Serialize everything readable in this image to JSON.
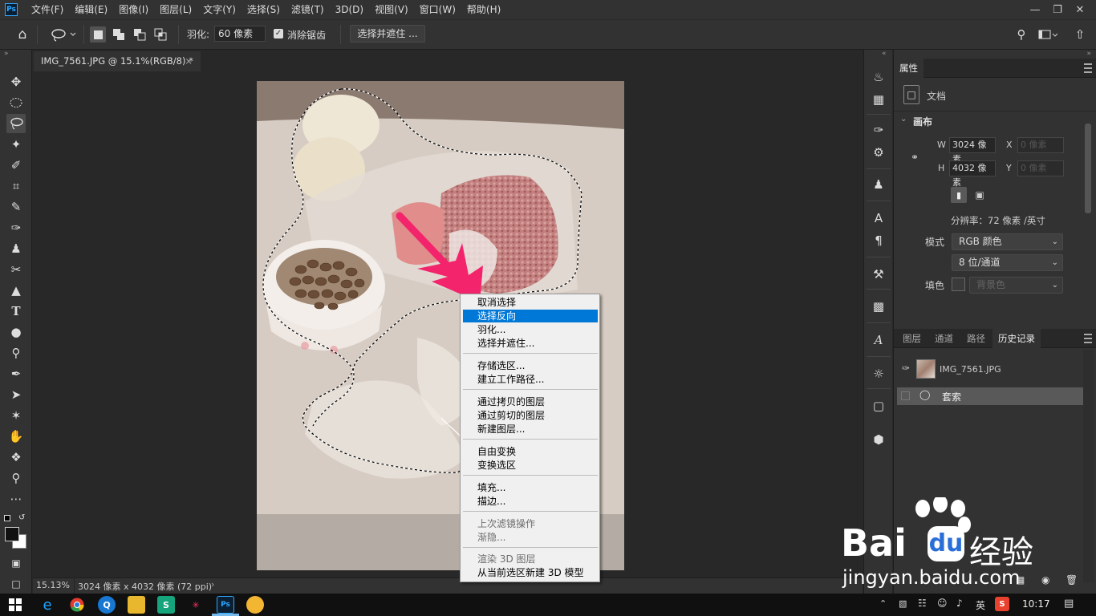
{
  "app": {
    "logo": "Ps",
    "colors": {
      "accent": "#31a8ff",
      "highlight": "#0078d7",
      "arrow": "#f3246c"
    }
  },
  "menubar": {
    "items": [
      "文件(F)",
      "编辑(E)",
      "图像(I)",
      "图层(L)",
      "文字(Y)",
      "选择(S)",
      "滤镜(T)",
      "3D(D)",
      "视图(V)",
      "窗口(W)",
      "帮助(H)"
    ]
  },
  "window_controls": [
    "minimize-icon",
    "restore-icon",
    "close-icon"
  ],
  "options": {
    "feather_label": "羽化:",
    "feather_value": "60 像素",
    "antialias_label": "消除锯齿",
    "antialias_checked": true,
    "refine_button": "选择并遮住 ..."
  },
  "document": {
    "tab_title": "IMG_7561.JPG @ 15.1%(RGB/8) *",
    "close": "×"
  },
  "status": {
    "zoom": "15.13%",
    "size": "3024 像素 x 4032 像素 (72 ppi)",
    "caret": "›"
  },
  "properties": {
    "tab": "属性",
    "doc_label": "文档",
    "canvas_label": "画布",
    "w_label": "W",
    "w_value": "3024 像素",
    "h_label": "H",
    "h_value": "4032 像素",
    "x_label": "X",
    "x_value": "0 像素",
    "y_label": "Y",
    "y_value": "0 像素",
    "resolution": "分辨率：72 像素 /英寸",
    "mode_label": "模式",
    "mode_value": "RGB 颜色",
    "depth_value": "8 位/通道",
    "fill_label": "填色",
    "fill_value": "背景色"
  },
  "layers_panel": {
    "tabs": [
      "图层",
      "通道",
      "路径",
      "历史记录"
    ],
    "active_tab": "历史记录",
    "snapshot_name": "IMG_7561.JPG",
    "history_step": "套索"
  },
  "context_menu": {
    "items": [
      {
        "label": "取消选择",
        "disabled": false
      },
      {
        "label": "选择反向",
        "disabled": false,
        "highlighted": true
      },
      {
        "label": "羽化...",
        "disabled": false
      },
      {
        "label": "选择并遮住...",
        "disabled": false
      },
      {
        "label": "存储选区...",
        "disabled": false
      },
      {
        "label": "建立工作路径...",
        "disabled": false
      },
      {
        "label": "通过拷贝的图层",
        "disabled": false
      },
      {
        "label": "通过剪切的图层",
        "disabled": false
      },
      {
        "label": "新建图层...",
        "disabled": false
      },
      {
        "label": "自由变换",
        "disabled": false
      },
      {
        "label": "变换选区",
        "disabled": false
      },
      {
        "label": "填充...",
        "disabled": false
      },
      {
        "label": "描边...",
        "disabled": false
      },
      {
        "label": "上次滤镜操作",
        "disabled": true
      },
      {
        "label": "渐隐...",
        "disabled": true
      },
      {
        "label": "渲染 3D 图层",
        "disabled": true
      },
      {
        "label": "从当前选区新建 3D 模型",
        "disabled": false
      }
    ]
  },
  "taskbar": {
    "ime": "英",
    "time": "10:17"
  },
  "watermark": {
    "brand": "Bai",
    "brand_cn": "经验",
    "url": "jingyan.baidu.com"
  }
}
